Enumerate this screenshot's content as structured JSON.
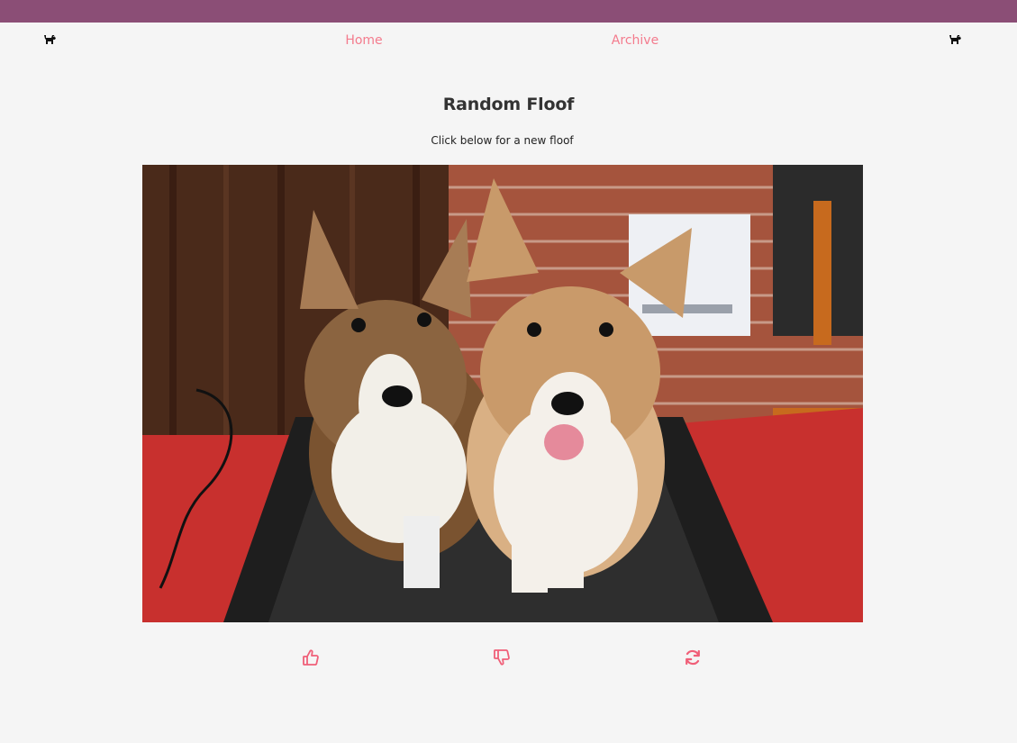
{
  "nav": {
    "left_icon": "dog-icon",
    "right_icon": "dog-icon",
    "links": [
      {
        "label": "Home"
      },
      {
        "label": "Archive"
      }
    ]
  },
  "main": {
    "title": "Random Floof",
    "subtitle": "Click below for a new floof",
    "image_subject": "two corgis running on a treadmill"
  },
  "actions": [
    {
      "icon": "thumbs-up-icon"
    },
    {
      "icon": "thumbs-down-icon"
    },
    {
      "icon": "refresh-icon"
    }
  ],
  "colors": {
    "topbar": "#8b4e76",
    "accent": "#f47b8d",
    "background": "#f5f5f5",
    "text": "#333333"
  }
}
